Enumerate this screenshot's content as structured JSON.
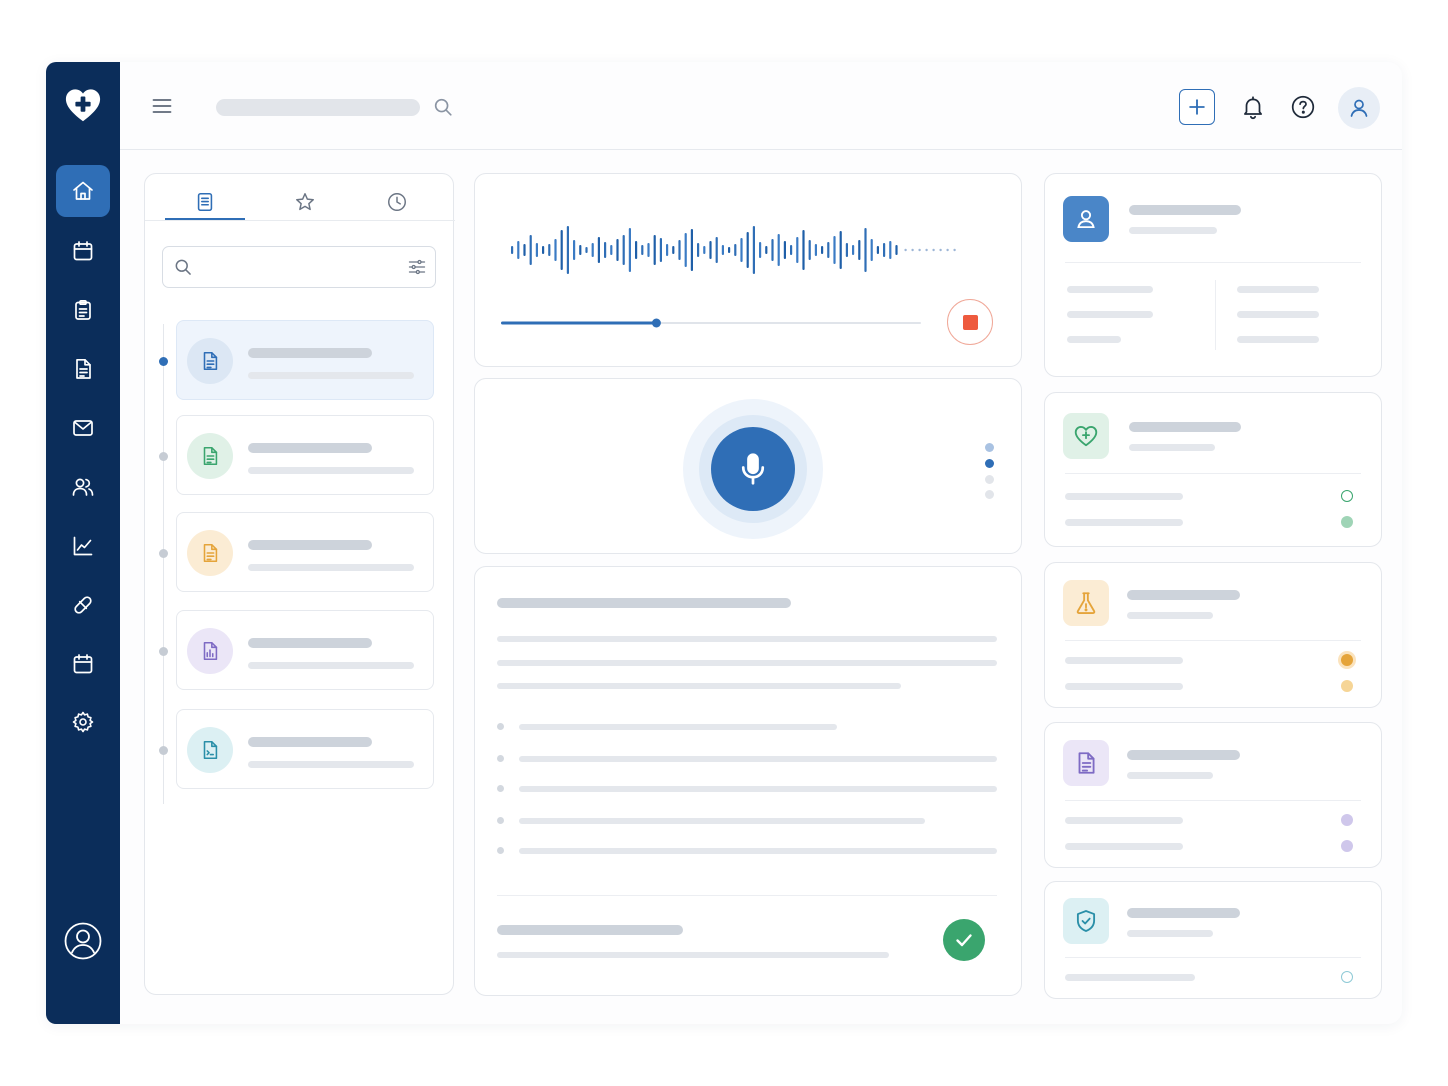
{
  "search": {
    "placeholder": ""
  },
  "filter": {
    "placeholder": ""
  },
  "colors": {
    "sidebar": "#0b2d5a",
    "accent": "#2f6eb6",
    "recording_stop": "#ee5a3e",
    "success": "#3aa56e",
    "vitals": "#3aa56e",
    "labs": "#e5a43a",
    "documents": "#7e6bc4",
    "insurance": "#2a8fa8"
  },
  "sidebar": {
    "items": [
      {
        "icon": "home-icon",
        "active": true
      },
      {
        "icon": "calendar-icon",
        "active": false
      },
      {
        "icon": "clipboard-icon",
        "active": false
      },
      {
        "icon": "document-icon",
        "active": false
      },
      {
        "icon": "mail-icon",
        "active": false
      },
      {
        "icon": "users-icon",
        "active": false
      },
      {
        "icon": "chart-icon",
        "active": false
      },
      {
        "icon": "pill-icon",
        "active": false
      },
      {
        "icon": "calendar-icon",
        "active": false
      },
      {
        "icon": "settings-icon",
        "active": false
      }
    ],
    "profile_icon": "user-circle-icon"
  },
  "topbar": {
    "icons": [
      "menu-icon",
      "search-icon",
      "plus-icon",
      "bell-icon",
      "help-icon",
      "user-icon"
    ]
  },
  "left_panel": {
    "tabs": [
      {
        "icon": "document-icon",
        "active": true
      },
      {
        "icon": "star-icon",
        "active": false
      },
      {
        "icon": "clock-icon",
        "active": false
      }
    ],
    "items": [
      {
        "icon": "document-icon",
        "color": "#2f6eb6",
        "active": true
      },
      {
        "icon": "document-icon",
        "color": "#3aa56e",
        "active": false
      },
      {
        "icon": "document-icon",
        "color": "#e5a43a",
        "active": false
      },
      {
        "icon": "document-chart-icon",
        "color": "#7e6bc4",
        "active": false
      },
      {
        "icon": "document-icon",
        "color": "#2a8fa8",
        "active": false
      }
    ]
  },
  "recording": {
    "progress": 0.37,
    "state": "recording",
    "mic_icon": "microphone-icon",
    "stop_icon": "stop-icon"
  },
  "right_cards": [
    {
      "icon": "user-icon",
      "color": "#2f6eb6"
    },
    {
      "icon": "heart-pulse-icon",
      "color": "#3aa56e"
    },
    {
      "icon": "flask-icon",
      "color": "#e5a43a"
    },
    {
      "icon": "document-icon",
      "color": "#7e6bc4"
    },
    {
      "icon": "shield-check-icon",
      "color": "#2a8fa8"
    }
  ]
}
